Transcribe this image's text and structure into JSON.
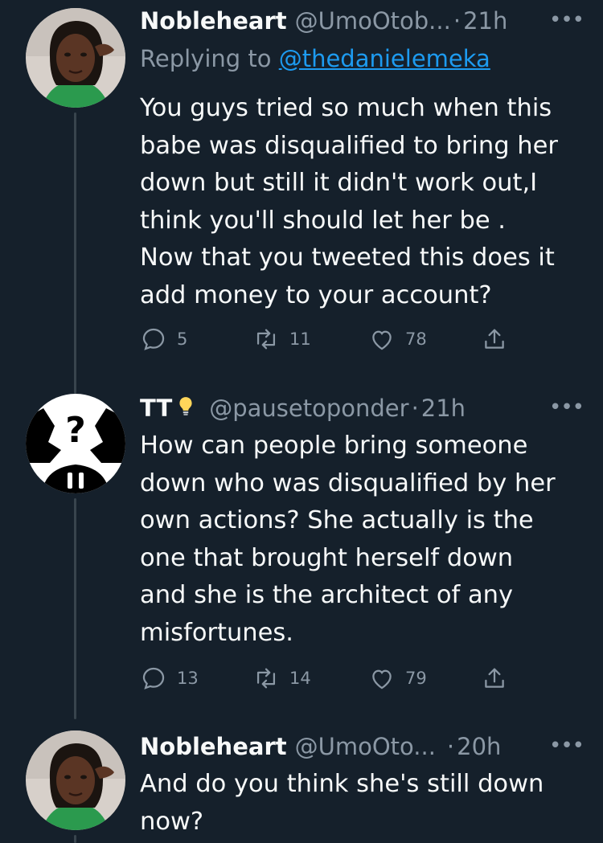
{
  "tweets": [
    {
      "name": "Nobleheart",
      "handle": "@UmoOtob...",
      "time": "21h",
      "replying_label": "Replying to",
      "replying_to": "@thedanielemeka",
      "text": "You guys tried so much when this\nbabe was disqualified to bring her\ndown but still it didn't work out,I\nthink you'll should let her be .\nNow that you tweeted this does it\nadd money to your account?",
      "replies": "5",
      "retweets": "11",
      "likes": "78"
    },
    {
      "name": "TT",
      "name_emoji": "lightbulb-icon",
      "handle": "@pausetoponder",
      "time": "21h",
      "text": "How can people bring someone\ndown who was disqualified by her\nown actions? She actually is the\none that brought herself down\nand she is the architect of any\nmisfortunes.",
      "replies": "13",
      "retweets": "14",
      "likes": "79"
    },
    {
      "name": "Nobleheart",
      "handle": "@UmoOto...",
      "time": "20h",
      "text": "And do you think she's still down\nnow?"
    }
  ],
  "colors": {
    "background": "#15202b",
    "text_primary": "#f7f9f9",
    "text_secondary": "#8b98a5",
    "link": "#1d9bf0",
    "thread_line": "#38444d"
  },
  "icons": [
    "reply-icon",
    "retweet-icon",
    "like-icon",
    "share-icon",
    "more-icon",
    "lightbulb-icon"
  ]
}
